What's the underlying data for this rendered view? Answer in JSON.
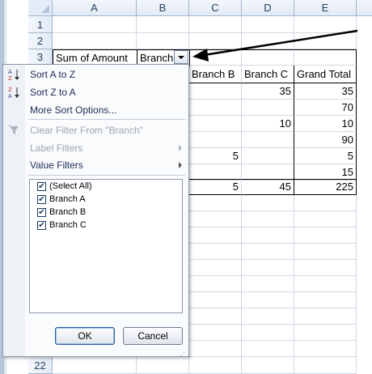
{
  "columns": [
    "A",
    "B",
    "C",
    "D",
    "E"
  ],
  "rows": [
    "1",
    "2",
    "3",
    "22"
  ],
  "pivot": {
    "header_label": "Sum of Amount",
    "field_label": "Branch",
    "col_headers": [
      "Branch B",
      "Branch C",
      "Grand Total"
    ],
    "rows": [
      {
        "b": "",
        "c": "35",
        "total": "35"
      },
      {
        "b": "",
        "c": "",
        "total": "70"
      },
      {
        "b": "",
        "c": "10",
        "total": "10"
      },
      {
        "b": "",
        "c": "",
        "total": "90"
      },
      {
        "b": "5",
        "c": "",
        "total": "5"
      },
      {
        "b": "",
        "c": "",
        "total": "15"
      }
    ],
    "grand": {
      "b": "5",
      "c": "45",
      "total": "225"
    }
  },
  "menu": {
    "sort_az": "Sort A to Z",
    "sort_za": "Sort Z to A",
    "more_sort": "More Sort Options...",
    "clear_filter": "Clear Filter From \"Branch\"",
    "label_filters": "Label Filters",
    "value_filters": "Value Filters",
    "checklist": [
      "(Select All)",
      "Branch A",
      "Branch B",
      "Branch C"
    ],
    "ok_label": "OK",
    "cancel_label": "Cancel",
    "az_icon_text": "A↓Z",
    "za_icon_text": "Z↓A"
  }
}
